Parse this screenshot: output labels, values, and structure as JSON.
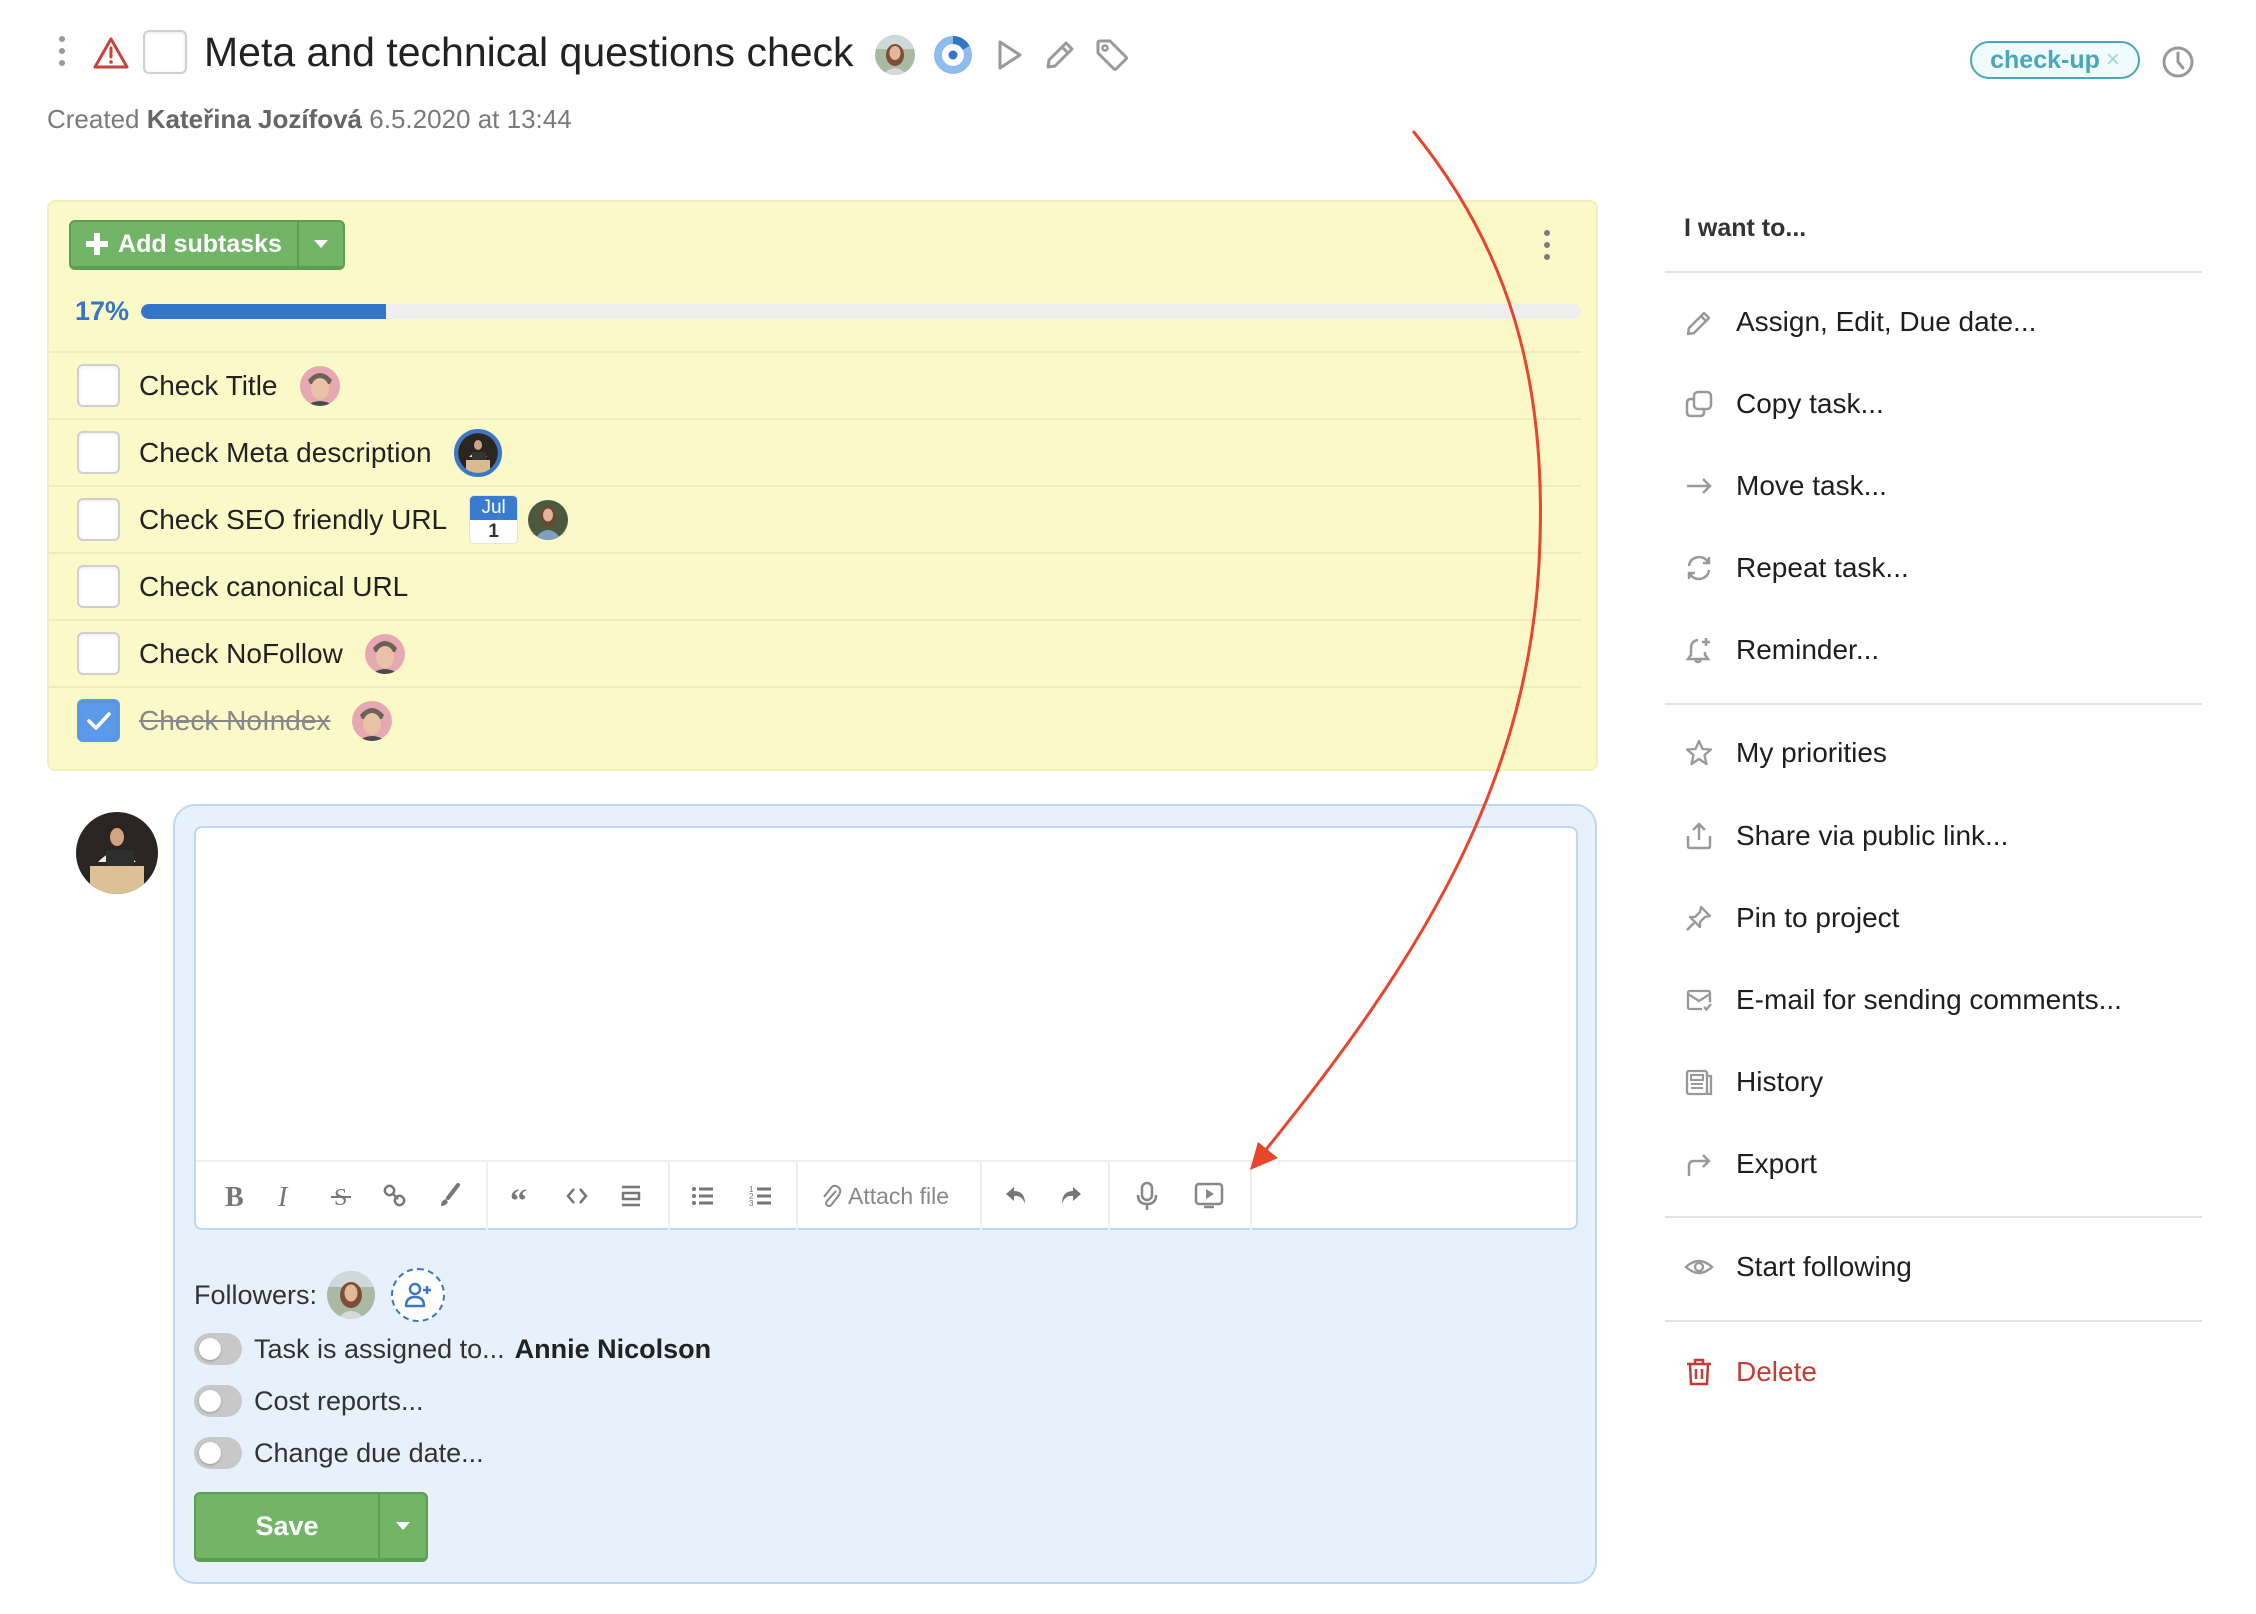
{
  "header": {
    "title": "Meta and technical questions check",
    "created_prefix": "Created",
    "created_by": "Kateřina Jozífová",
    "created_at": "6.5.2020 at 13:44",
    "progress_percent": 17,
    "tag": "check-up",
    "tag_remove": "×",
    "icons": [
      "kebab-menu-icon",
      "warning-icon",
      "play-icon",
      "pencil-icon",
      "tag-icon",
      "clock-icon"
    ]
  },
  "subtasks": {
    "add_label": "Add subtasks",
    "progress_label": "17%",
    "progress_value": 0.17,
    "items": [
      {
        "label": "Check Title",
        "done": false,
        "assignee": "man-avatar",
        "due": null
      },
      {
        "label": "Check Meta description",
        "done": false,
        "assignee": "laptop-man-avatar",
        "due": null
      },
      {
        "label": "Check SEO friendly URL",
        "done": false,
        "assignee": "woman-avatar",
        "due": {
          "month": "Jul",
          "day": "1"
        }
      },
      {
        "label": "Check canonical URL",
        "done": false,
        "assignee": null,
        "due": null
      },
      {
        "label": "Check NoFollow",
        "done": false,
        "assignee": "man-avatar",
        "due": null
      },
      {
        "label": "Check NoIndex",
        "done": true,
        "assignee": "man-avatar",
        "due": null
      }
    ]
  },
  "comment": {
    "editor_value": "",
    "toolbar": {
      "attach_label": "Attach file",
      "buttons": [
        "bold",
        "italic",
        "strikethrough",
        "link",
        "highlight",
        "quote",
        "code",
        "horizontal-rule",
        "bullet-list",
        "numbered-list",
        "attach-file",
        "undo",
        "redo",
        "microphone",
        "video"
      ]
    },
    "followers_label": "Followers:",
    "options": [
      {
        "label": "Task is assigned to...",
        "value": "Annie Nicolson",
        "on": false
      },
      {
        "label": "Cost reports...",
        "value": "",
        "on": false
      },
      {
        "label": "Change due date...",
        "value": "",
        "on": false
      }
    ],
    "save_label": "Save"
  },
  "menu": {
    "title": "I want to...",
    "groups": [
      [
        {
          "label": "Assign, Edit, Due date...",
          "icon": "pencil-icon"
        },
        {
          "label": "Copy task...",
          "icon": "copy-icon"
        },
        {
          "label": "Move task...",
          "icon": "arrow-right-icon"
        },
        {
          "label": "Repeat task...",
          "icon": "repeat-icon"
        },
        {
          "label": "Reminder...",
          "icon": "bell-plus-icon"
        }
      ],
      [
        {
          "label": "My priorities",
          "icon": "star-icon"
        },
        {
          "label": "Share via public link...",
          "icon": "share-icon"
        },
        {
          "label": "Pin to project",
          "icon": "pin-icon"
        },
        {
          "label": "E-mail for sending comments...",
          "icon": "email-icon"
        },
        {
          "label": "History",
          "icon": "history-icon"
        },
        {
          "label": "Export",
          "icon": "export-icon"
        }
      ],
      [
        {
          "label": "Start following",
          "icon": "eye-icon"
        }
      ],
      [
        {
          "label": "Delete",
          "icon": "trash-icon"
        }
      ]
    ]
  },
  "colors": {
    "accent_blue": "#3375c8",
    "save_green": "#72b566",
    "subtasks_bg": "#fcf9c9",
    "comment_bg": "#e6f1fc",
    "tag_teal": "#4aa7ba",
    "danger_red": "#c43c35",
    "annotation_arrow": "#e8452c"
  }
}
